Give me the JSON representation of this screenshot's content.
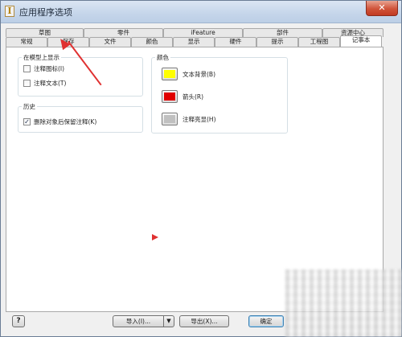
{
  "window": {
    "title": "应用程序选项",
    "close_glyph": "✕",
    "app_icon_glyph": "I"
  },
  "tabs": {
    "back_row": [
      "草图",
      "零件",
      "iFeature",
      "部件",
      "资源中心"
    ],
    "front_row": [
      "常规",
      "保存",
      "文件",
      "颜色",
      "显示",
      "硬件",
      "提示",
      "工程图",
      "记事本"
    ],
    "active": "记事本"
  },
  "groups": {
    "model_display": {
      "title": "在模型上显示",
      "items": [
        {
          "label": "注释图标(I)",
          "checked": false
        },
        {
          "label": "注释文本(T)",
          "checked": false
        }
      ]
    },
    "history": {
      "title": "历史",
      "items": [
        {
          "label": "删除对象后保留注释(K)",
          "checked": true
        }
      ]
    },
    "color": {
      "title": "颜色",
      "items": [
        {
          "label": "文本背景(B)",
          "color": "#ffff00"
        },
        {
          "label": "箭头(R)",
          "color": "#e00000"
        },
        {
          "label": "注释亮显(H)",
          "color": "#c0c0c0"
        }
      ]
    }
  },
  "buttons": {
    "help": "?",
    "import": "导入(I)...",
    "import_dropdown": "▼",
    "export": "导出(X)...",
    "ok": "确定"
  },
  "check_glyph": "✓",
  "annotation_color": "#e03131"
}
